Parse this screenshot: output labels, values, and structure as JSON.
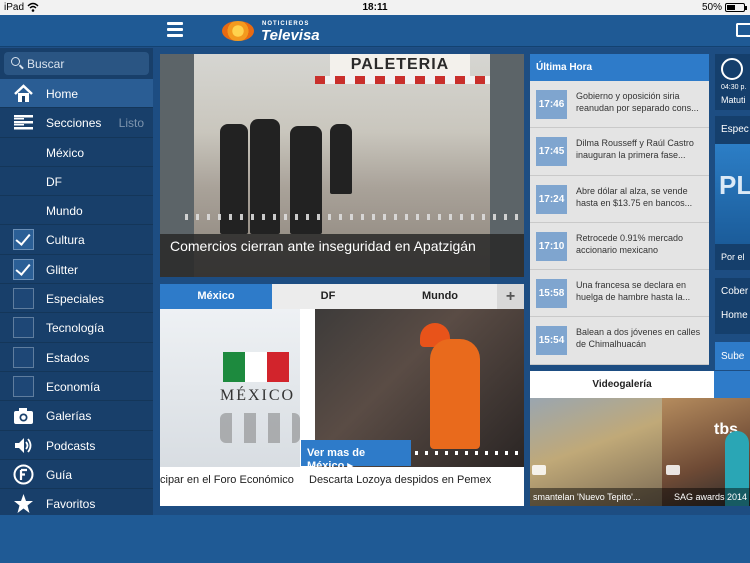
{
  "status": {
    "carrier": "iPad",
    "time": "18:11",
    "battery": "50%",
    "battery_level": 0.5
  },
  "header": {
    "logo_small": "NOTICIEROS",
    "logo_big": "Televisa"
  },
  "search": {
    "placeholder": "Buscar"
  },
  "sidebar": {
    "items": [
      {
        "label": "Home",
        "icon": "home-icon",
        "active": true
      },
      {
        "label": "Secciones",
        "aux": "Listo",
        "icon": "sections-icon"
      },
      {
        "label": "México"
      },
      {
        "label": "DF"
      },
      {
        "label": "Mundo"
      },
      {
        "label": "Cultura",
        "checked": true
      },
      {
        "label": "Glitter",
        "checked": true
      },
      {
        "label": "Especiales",
        "checked": false
      },
      {
        "label": "Tecnología",
        "checked": false
      },
      {
        "label": "Estados",
        "checked": false
      },
      {
        "label": "Economía",
        "checked": false
      },
      {
        "label": "Galerías",
        "icon": "camera-icon"
      },
      {
        "label": "Podcasts",
        "icon": "speaker-icon"
      },
      {
        "label": "Guía",
        "icon": "guide-icon"
      },
      {
        "label": "Favoritos",
        "icon": "star-icon"
      }
    ]
  },
  "hero": {
    "sign": "PALETERIA",
    "caption": "Comercios cierran ante inseguridad en Apatzigán"
  },
  "tabs": {
    "items": [
      "México",
      "DF",
      "Mundo"
    ],
    "plus": "+"
  },
  "news_box": {
    "flag_text": "MÉXICO",
    "see_more": "Ver mas de México ▸",
    "headline_left": "cipar en el Foro Económico",
    "headline_right": "Descarta Lozoya despidos en Pemex"
  },
  "ultima_hora": {
    "title": "Última Hora",
    "items": [
      {
        "time": "17:46",
        "text": "Gobierno y oposición siria reanudan por separado cons..."
      },
      {
        "time": "17:45",
        "text": "Dilma Rousseff y Raúl Castro inauguran la primera fase..."
      },
      {
        "time": "17:24",
        "text": "Abre dólar al alza, se vende hasta en $13.75 en bancos..."
      },
      {
        "time": "17:10",
        "text": "Retrocede 0.91% mercado accionario mexicano"
      },
      {
        "time": "15:58",
        "text": "Una francesa se declara en huelga de hambre hasta la..."
      },
      {
        "time": "15:54",
        "text": "Balean a dos jóvenes en calles de Chimalhuacán"
      }
    ]
  },
  "video": {
    "title": "Videogalería",
    "tbs": "tbs",
    "cap1": "smantelan 'Nuevo Tepito'...",
    "cap2": "SAG awards 2014"
  },
  "right_col": {
    "time": "04:30 p.",
    "show": "Matuti",
    "espec": "Espec",
    "pl": "PL",
    "porel": "Por el",
    "cober": "Cober",
    "home": "Home",
    "sube": "Sube"
  },
  "colors": {
    "accent": "#2e7bc9",
    "sidebar": "#183f6a",
    "header": "#1f5a95"
  }
}
